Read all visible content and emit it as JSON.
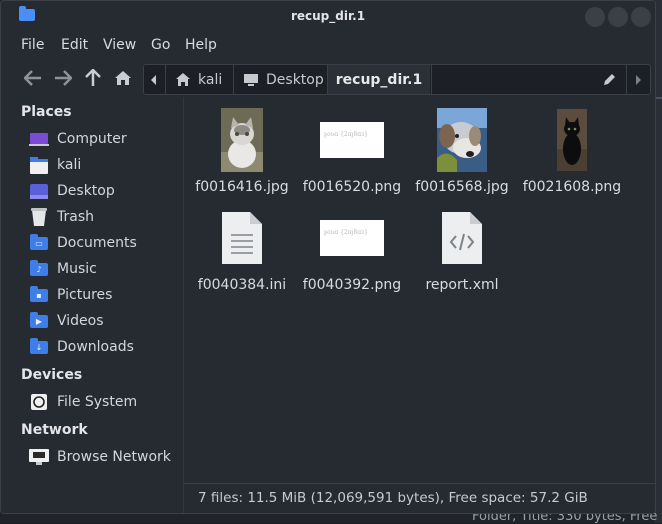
{
  "window": {
    "title": "recup_dir.1"
  },
  "menu": [
    "File",
    "Edit",
    "View",
    "Go",
    "Help"
  ],
  "toolbar": {
    "path": [
      "kali",
      "Desktop",
      "recup_dir.1"
    ]
  },
  "sidebar": {
    "places_title": "Places",
    "places": [
      {
        "label": "Computer",
        "icon": "computer-icon"
      },
      {
        "label": "kali",
        "icon": "home-folder-icon"
      },
      {
        "label": "Desktop",
        "icon": "desktop-icon"
      },
      {
        "label": "Trash",
        "icon": "trash-icon"
      },
      {
        "label": "Documents",
        "icon": "documents-folder-icon"
      },
      {
        "label": "Music",
        "icon": "music-folder-icon"
      },
      {
        "label": "Pictures",
        "icon": "pictures-folder-icon"
      },
      {
        "label": "Videos",
        "icon": "videos-folder-icon"
      },
      {
        "label": "Downloads",
        "icon": "downloads-folder-icon"
      }
    ],
    "devices_title": "Devices",
    "devices": [
      {
        "label": "File System",
        "icon": "drive-icon"
      }
    ],
    "network_title": "Network",
    "network": [
      {
        "label": "Browse Network",
        "icon": "network-icon"
      }
    ]
  },
  "files": [
    {
      "name": "f0016416.jpg",
      "kind": "cat-photo"
    },
    {
      "name": "f0016520.png",
      "kind": "text-image"
    },
    {
      "name": "f0016568.jpg",
      "kind": "dog-photo"
    },
    {
      "name": "f0021608.png",
      "kind": "black-cat-photo"
    },
    {
      "name": "f0040384.ini",
      "kind": "text-doc"
    },
    {
      "name": "f0040392.png",
      "kind": "text-image"
    },
    {
      "name": "report.xml",
      "kind": "xml-doc"
    }
  ],
  "status": "7 files: 11.5 MiB (12,069,591 bytes), Free space: 57.2 GiB",
  "background_text": "Folder, Title: 330 bytes, Free",
  "colors": {
    "accent": "#3f7ee8",
    "window_bg": "#262a31"
  }
}
